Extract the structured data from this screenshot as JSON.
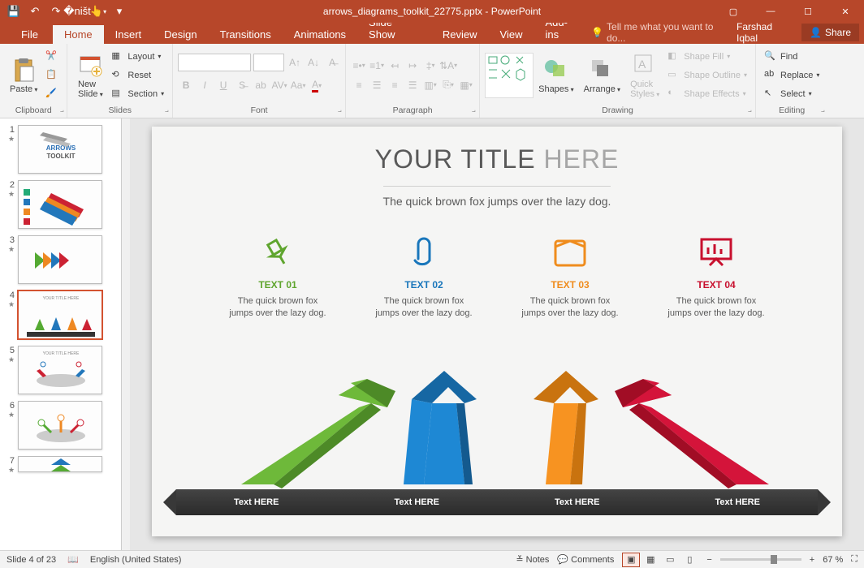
{
  "titlebar": {
    "filename": "arrows_diagrams_toolkit_22775.pptx",
    "app": "PowerPoint"
  },
  "tabs": {
    "file": "File",
    "home": "Home",
    "insert": "Insert",
    "design": "Design",
    "transitions": "Transitions",
    "animations": "Animations",
    "slideshow": "Slide Show",
    "review": "Review",
    "view": "View",
    "addins": "Add-ins",
    "tellme": "Tell me what you want to do...",
    "user": "Farshad Iqbal",
    "share": "Share"
  },
  "ribbon": {
    "clipboard": {
      "label": "Clipboard",
      "paste": "Paste"
    },
    "slides": {
      "label": "Slides",
      "newslide": "New\nSlide",
      "layout": "Layout",
      "reset": "Reset",
      "section": "Section"
    },
    "font": {
      "label": "Font"
    },
    "paragraph": {
      "label": "Paragraph"
    },
    "drawing": {
      "label": "Drawing",
      "shapes": "Shapes",
      "arrange": "Arrange",
      "quick": "Quick\nStyles",
      "fill": "Shape Fill",
      "outline": "Shape Outline",
      "effects": "Shape Effects"
    },
    "editing": {
      "label": "Editing",
      "find": "Find",
      "replace": "Replace",
      "select": "Select"
    }
  },
  "thumbs": {
    "count": 7,
    "active": 4,
    "title1": "ARROWS TOOLKIT"
  },
  "slide": {
    "title_a": "YOUR TITLE ",
    "title_b": "HERE",
    "subtitle": "The quick brown fox jumps over the lazy dog.",
    "cols": [
      {
        "title": "TEXT 01",
        "body": "The quick brown fox jumps over the lazy dog."
      },
      {
        "title": "TEXT 02",
        "body": "The quick brown fox jumps over the lazy dog."
      },
      {
        "title": "TEXT 03",
        "body": "The quick brown fox jumps over the lazy dog."
      },
      {
        "title": "TEXT 04",
        "body": "The quick brown fox jumps over the lazy dog."
      }
    ],
    "bar": [
      "Text HERE",
      "Text HERE",
      "Text HERE",
      "Text HERE"
    ]
  },
  "status": {
    "slide": "Slide 4 of 23",
    "lang": "English (United States)",
    "notes": "Notes",
    "comments": "Comments",
    "zoom": "67 %"
  }
}
